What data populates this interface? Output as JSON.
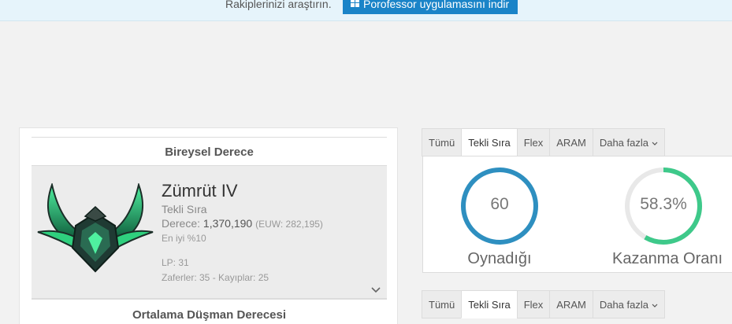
{
  "promo": {
    "text": "Rakiplerinizi araştırın.",
    "button_label": "Porofessor uygulamasını indir",
    "button_icon": "windows-icon"
  },
  "individual_rank": {
    "heading": "Bireysel Derece",
    "tier": "Zümrüt IV",
    "queue": "Tekli Sıra",
    "rank_label": "Derece:",
    "rank_value": "1,370,190",
    "euw": "(EUW: 282,195)",
    "top_percent": "En iyi %10",
    "lp": "LP: 31",
    "wins_losses": "Zaferler: 35 - Kayıplar: 25",
    "emblem_icon": "emerald-rank-emblem-icon",
    "expand_icon": "chevron-down-icon"
  },
  "enemy_rank": {
    "heading": "Ortalama Düşman Derecesi"
  },
  "queue_tabs": [
    {
      "label": "Tümü"
    },
    {
      "label": "Tekli Sıra"
    },
    {
      "label": "Flex"
    },
    {
      "label": "ARAM"
    },
    {
      "label": "Daha fazla"
    }
  ],
  "active_tab": "Tekli Sıra",
  "stats": {
    "played_value": "60",
    "played_label": "Oynadığı",
    "winrate_value": "58.3%",
    "winrate_label": "Kazanma Oranı",
    "winrate_fraction": 0.583
  },
  "colors": {
    "accent_blue": "#1a84c8",
    "played_ring": "#2e8fc0",
    "winrate_ring": "#3ec98a",
    "emerald": "#2fd07e"
  }
}
